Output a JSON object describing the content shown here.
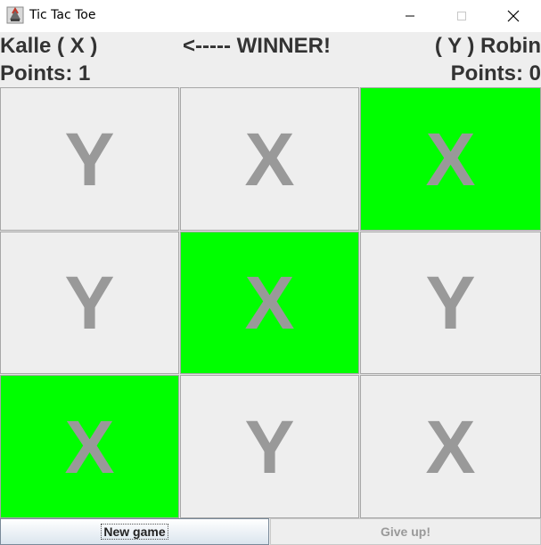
{
  "window": {
    "title": "Tic Tac Toe",
    "icon": "java-cup-icon"
  },
  "header": {
    "player1_name": "Kalle ( X )",
    "player1_points": "Points: 1",
    "status": "<----- WINNER!",
    "player2_name": "( Y ) Robin",
    "player2_points": "Points: 0"
  },
  "board": {
    "cells": [
      {
        "mark": "Y",
        "winning": false
      },
      {
        "mark": "X",
        "winning": false
      },
      {
        "mark": "X",
        "winning": true
      },
      {
        "mark": "Y",
        "winning": false
      },
      {
        "mark": "X",
        "winning": true
      },
      {
        "mark": "Y",
        "winning": false
      },
      {
        "mark": "X",
        "winning": true
      },
      {
        "mark": "Y",
        "winning": false
      },
      {
        "mark": "X",
        "winning": false
      }
    ]
  },
  "buttons": {
    "new_game": "New game",
    "give_up": "Give up!",
    "give_up_enabled": false
  },
  "colors": {
    "win_cell": "#00ff00",
    "cell": "#eeeeee",
    "mark": "#999999"
  }
}
